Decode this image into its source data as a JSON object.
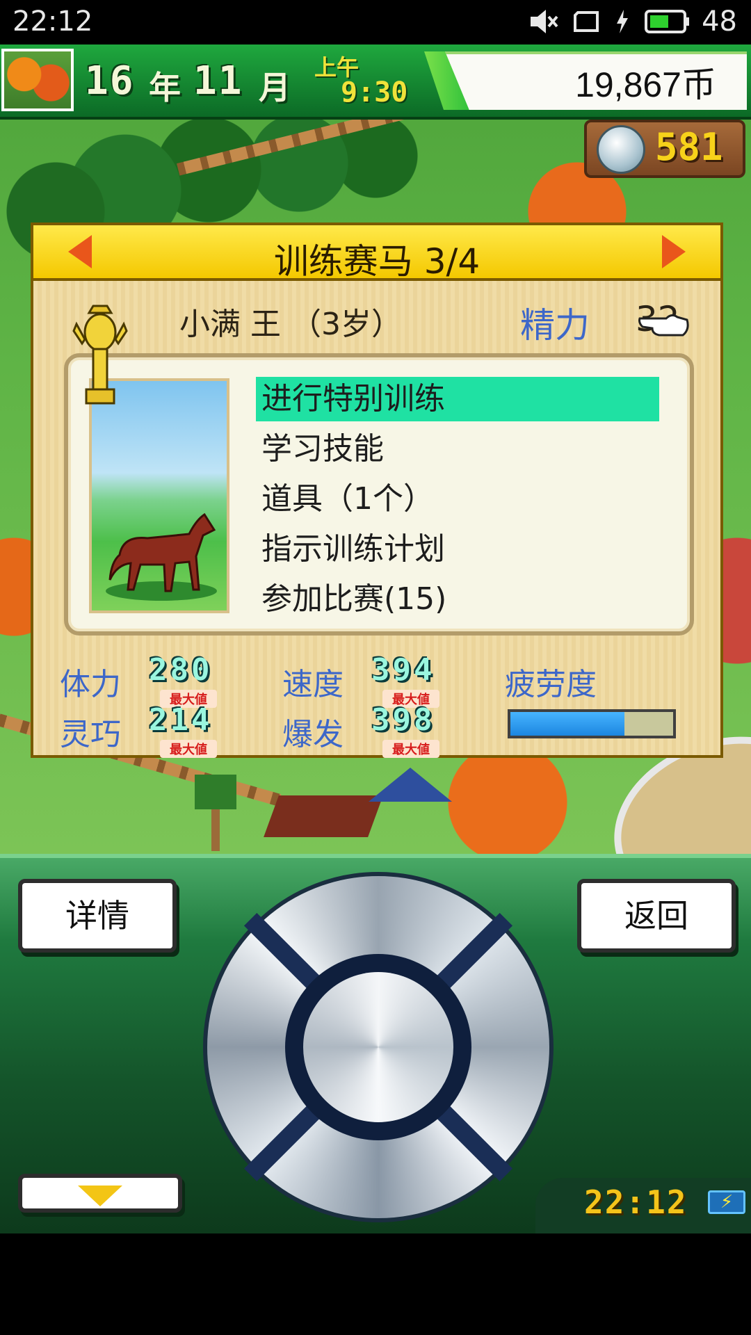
{
  "status_bar": {
    "time": "22:12",
    "battery_level": "48",
    "icons": [
      "mute-icon",
      "screen-rotate-icon",
      "charging-icon",
      "battery-icon"
    ]
  },
  "top_bar": {
    "year": "16",
    "year_unit": "年",
    "month": "11",
    "month_unit": "月",
    "ampm": "上午",
    "clock": "9:30",
    "money": "19,867币"
  },
  "medals": {
    "count": "581"
  },
  "dialog": {
    "title": "训练赛马 3/4",
    "horse_name": "小满 王 （3岁）",
    "energy_label": "精力",
    "energy_value": "32",
    "menu": [
      {
        "label": "进行特别训练",
        "selected": true
      },
      {
        "label": "学习技能",
        "selected": false
      },
      {
        "label": "道具（1个）",
        "selected": false
      },
      {
        "label": "指示训练计划",
        "selected": false
      },
      {
        "label": "参加比赛(15)",
        "selected": false
      }
    ],
    "stats": {
      "stamina_label": "体力",
      "stamina_value": "280",
      "speed_label": "速度",
      "speed_value": "394",
      "agility_label": "灵巧",
      "agility_value": "214",
      "burst_label": "爆发",
      "burst_value": "398",
      "max_tag": "最大値",
      "fatigue_label": "疲劳度",
      "fatigue_level": 0.7
    }
  },
  "controller": {
    "detail_label": "详情",
    "back_label": "返回",
    "clock": "22:12"
  },
  "colors": {
    "title_bar": "#f4c800",
    "menu_highlight": "#1fe1a3",
    "stat_label": "#3d67c9",
    "fatigue_fill": "#1c86e0"
  }
}
